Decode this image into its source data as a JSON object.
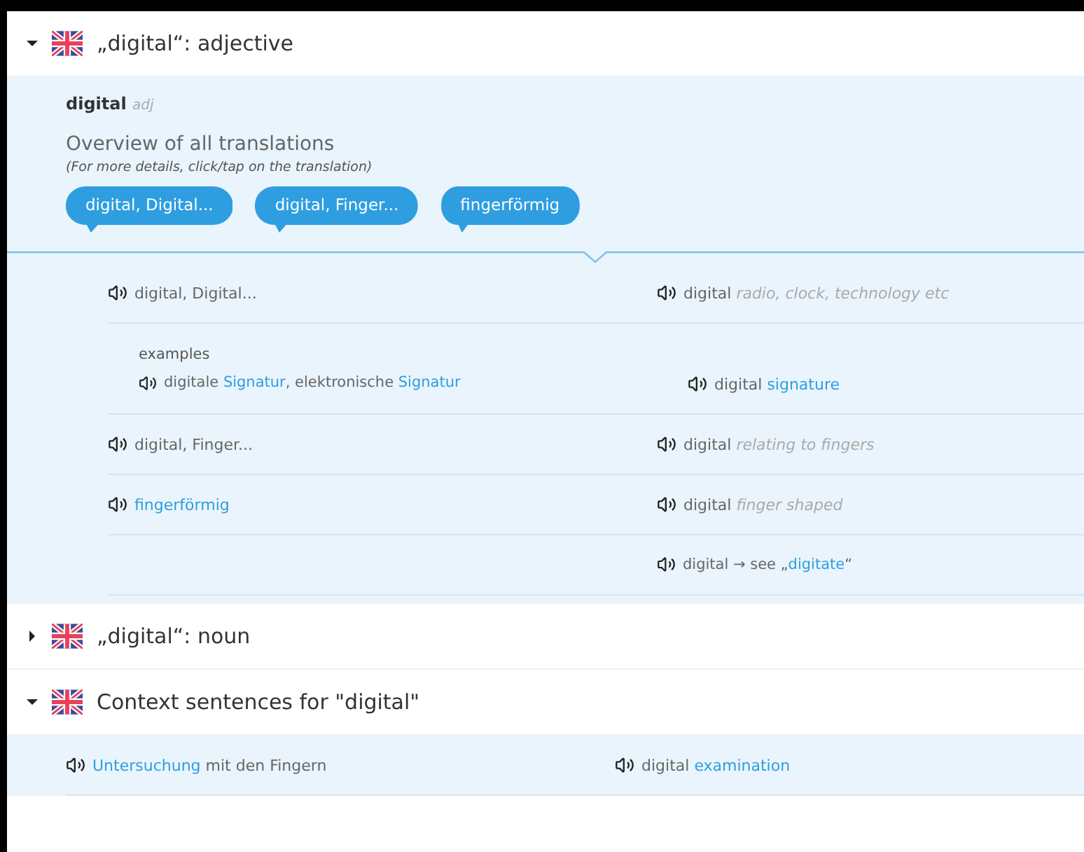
{
  "sections": [
    {
      "title": "„digital“: adjective",
      "expanded": true,
      "kind": "dictionary",
      "headword": "digital",
      "pos": "adj",
      "overview_title": "Overview of all translations",
      "overview_hint": "(For more details, click/tap on the translation)",
      "bubbles": [
        "digital, Digital...",
        "digital, Finger...",
        "fingerförmig"
      ],
      "rows": [
        {
          "kind": "translation",
          "left": [
            {
              "text": "digital, Digital..."
            }
          ],
          "right": [
            {
              "text": "digital "
            },
            {
              "text": "radio, clock, technology etc",
              "kind": "gloss"
            }
          ]
        },
        {
          "kind": "examples",
          "label": "examples",
          "left": [
            {
              "text": "digitale "
            },
            {
              "text": "Signatur",
              "kind": "link"
            },
            {
              "text": ", elektronische "
            },
            {
              "text": "Signatur",
              "kind": "link"
            }
          ],
          "right": [
            {
              "text": "digital "
            },
            {
              "text": "signature",
              "kind": "link"
            }
          ]
        },
        {
          "kind": "translation",
          "left": [
            {
              "text": "digital, Finger..."
            }
          ],
          "right": [
            {
              "text": "digital "
            },
            {
              "text": "relating to fingers",
              "kind": "gloss"
            }
          ]
        },
        {
          "kind": "translation",
          "left": [
            {
              "text": "fingerförmig",
              "kind": "link"
            }
          ],
          "right": [
            {
              "text": "digital "
            },
            {
              "text": "finger shaped",
              "kind": "gloss"
            }
          ]
        },
        {
          "kind": "reference",
          "left": [],
          "right": [
            {
              "text": "digital → see „"
            },
            {
              "text": "digitate",
              "kind": "link"
            },
            {
              "text": "“"
            }
          ]
        }
      ]
    },
    {
      "title": "„digital“: noun",
      "expanded": false
    },
    {
      "title": "Context sentences for \"digital\"",
      "expanded": true,
      "kind": "context",
      "rows": [
        {
          "kind": "context",
          "left": [
            {
              "text": "Untersuchung",
              "kind": "link"
            },
            {
              "text": " mit den Fingern"
            }
          ],
          "right": [
            {
              "text": "digital "
            },
            {
              "text": "examination",
              "kind": "link"
            }
          ]
        }
      ]
    }
  ]
}
